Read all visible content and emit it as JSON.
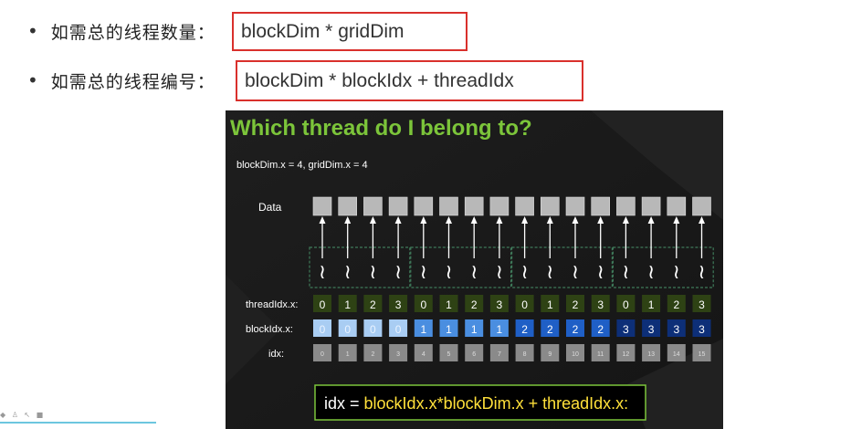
{
  "bullets": [
    {
      "label": "如需总的线程数量：",
      "formula": "blockDim * gridDim"
    },
    {
      "label": "如需总的线程编号：",
      "formula": "blockDim * blockIdx + threadIdx"
    }
  ],
  "slide": {
    "title": "Which thread do I belong to?",
    "params": "blockDim.x = 4, gridDim.x = 4",
    "data_label": "Data",
    "row_labels": {
      "thread": "threadIdx.x:",
      "block": "blockIdx.x:",
      "idx": "idx:"
    },
    "threadIdx": [
      "0",
      "1",
      "2",
      "3",
      "0",
      "1",
      "2",
      "3",
      "0",
      "1",
      "2",
      "3",
      "0",
      "1",
      "2",
      "3"
    ],
    "blockIdx": [
      "0",
      "0",
      "0",
      "0",
      "1",
      "1",
      "1",
      "1",
      "2",
      "2",
      "2",
      "2",
      "3",
      "3",
      "3",
      "3"
    ],
    "idx": [
      "0",
      "1",
      "2",
      "3",
      "4",
      "5",
      "6",
      "7",
      "8",
      "9",
      "10",
      "11",
      "12",
      "13",
      "14",
      "15"
    ],
    "thread_glyph": "≀",
    "formula": {
      "lhs": "idx = ",
      "rhs": "blockIdx.x*blockDim.x + threadIdx.x:"
    },
    "colors": {
      "title": "#7cc53a",
      "thread_cell": "#2e4214",
      "block_cells": [
        "#a9cdf3",
        "#4a8ee0",
        "#1f5fc6",
        "#0d2f78"
      ],
      "idx_cell": "#8a8a8a",
      "data_cell": "#b8b8b8",
      "formula_border": "#7cc53a",
      "formula_rhs": "#ffe03a"
    }
  },
  "bottom_bar": {
    "icons": [
      "diamond-icon",
      "person-icon",
      "cursor-icon",
      "camera-icon"
    ],
    "glyphs": "◆ ♙ ↖ ■"
  }
}
